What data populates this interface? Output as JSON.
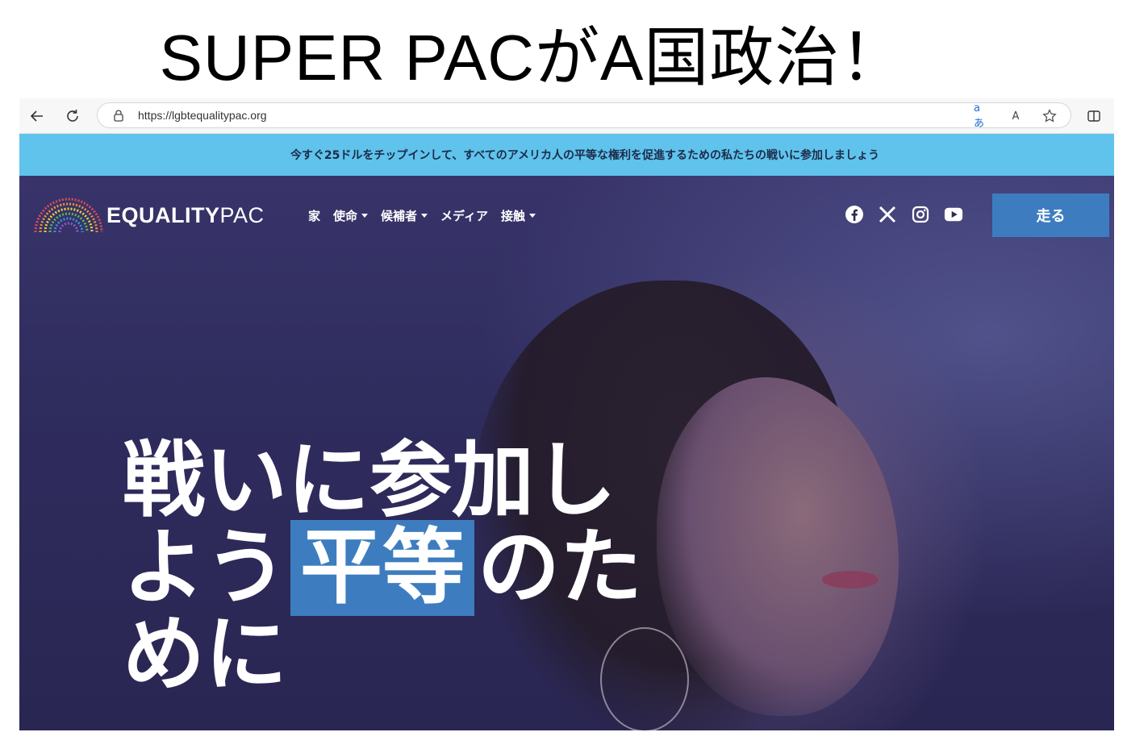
{
  "slide": {
    "title": "SUPER PACがA国政治！"
  },
  "browser": {
    "url": "https://lgbtequalitypac.org",
    "translate_label": "aあ",
    "read_aloud_label": "A"
  },
  "banner": {
    "text": "今すぐ25ドルをチップインして、すべてのアメリカ人の平等な権利を促進するための私たちの戦いに参加しましょう"
  },
  "site": {
    "logo_bold": "EQUALITY",
    "logo_light": "PAC",
    "nav": [
      {
        "label": "家",
        "dropdown": false
      },
      {
        "label": "使命",
        "dropdown": true
      },
      {
        "label": "候補者",
        "dropdown": true
      },
      {
        "label": "メディア",
        "dropdown": false
      },
      {
        "label": "接触",
        "dropdown": true
      }
    ],
    "socials": [
      "facebook-icon",
      "x-icon",
      "instagram-icon",
      "youtube-icon"
    ],
    "cta_label": "走る"
  },
  "hero": {
    "line1": "戦いに参加し",
    "line2_pre": "よう",
    "line2_highlight": "平等",
    "line2_post": "のた",
    "line3": "めに"
  },
  "colors": {
    "banner": "#5fc3ec",
    "accent": "#3d7dbf",
    "hero_bg": "#2e2a52"
  }
}
